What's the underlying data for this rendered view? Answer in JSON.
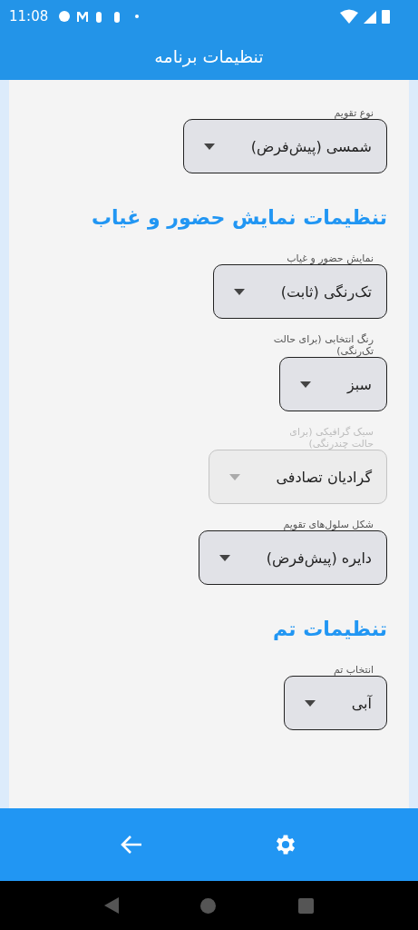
{
  "status_bar": {
    "time": "11:08"
  },
  "app_bar": {
    "title": "تنظیمات برنامه"
  },
  "sections": [
    {
      "fields": [
        {
          "label": "نوع تقویم",
          "value": "شمسی (پیش‌فرض)",
          "disabled": false
        }
      ]
    },
    {
      "heading": "تنظیمات نمایش حضور و غیاب",
      "fields": [
        {
          "label": "نمایش حضور و غیاب",
          "value": "تک‌رنگی (ثابت)",
          "disabled": false
        },
        {
          "label": "رنگ انتخابی (برای حالت تک‌رنگی)",
          "value": "سبز",
          "disabled": false
        },
        {
          "label": "سبک گرافیکی (برای حالت چندرنگی)",
          "value": "گرادیان تصادفی",
          "disabled": true
        },
        {
          "label": "شکل سلول‌های تقویم",
          "value": "دایره (پیش‌فرض)",
          "disabled": false
        }
      ]
    },
    {
      "heading": "تنظیمات تم",
      "fields": [
        {
          "label": "انتخاب تم",
          "value": "آبی",
          "disabled": false
        }
      ]
    }
  ]
}
